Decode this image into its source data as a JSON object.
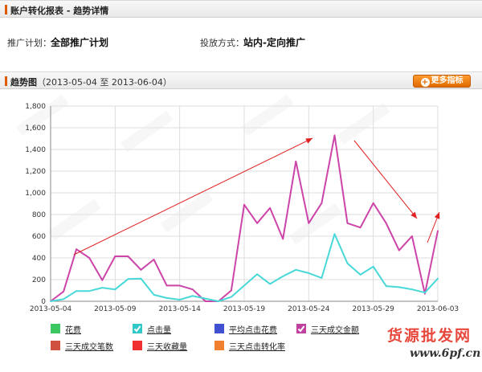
{
  "report": {
    "title": "账户转化报表",
    "separator": " - ",
    "subtitle": "趋势详情"
  },
  "filters": {
    "plan_label": "推广计划：",
    "plan_value": "全部推广计划",
    "mode_label": "投放方式：",
    "mode_value": "站内-定向推广"
  },
  "trend": {
    "title": "趋势图",
    "range": "（2013-05-04 至 2013-06-04）",
    "more_button": "更多指标",
    "more_plus": "+"
  },
  "chart_data": {
    "type": "line",
    "y_ticks": [
      "0",
      "200",
      "400",
      "600",
      "800",
      "1,000",
      "1,200",
      "1,400",
      "1,600",
      "1,800"
    ],
    "ylim": [
      0,
      1800
    ],
    "x_labels": [
      "2013-05-04",
      "2013-05-09",
      "2013-05-14",
      "2013-05-19",
      "2013-05-24",
      "2013-05-29",
      "2013-06-03"
    ],
    "x_count": 31,
    "grid": true,
    "series": [
      {
        "name": "三天成交金额",
        "color": "#cc44a8",
        "values": [
          0,
          90,
          480,
          400,
          195,
          415,
          415,
          290,
          385,
          145,
          145,
          110,
          0,
          0,
          100,
          890,
          720,
          860,
          575,
          1290,
          720,
          905,
          1530,
          720,
          680,
          905,
          720,
          470,
          600,
          70,
          650
        ]
      },
      {
        "name": "点击量",
        "color": "#48d8d8",
        "values": [
          0,
          20,
          95,
          95,
          125,
          110,
          205,
          210,
          60,
          30,
          15,
          50,
          25,
          0,
          40,
          145,
          250,
          160,
          230,
          290,
          260,
          215,
          620,
          350,
          245,
          320,
          140,
          130,
          110,
          80,
          210
        ]
      }
    ]
  },
  "legend": [
    {
      "label": "花费",
      "color": "#3cc860",
      "icon": "check-icon"
    },
    {
      "label": "点击量",
      "color": "#30c8c8",
      "icon": "check-icon",
      "checked": true
    },
    {
      "label": "平均点击花费",
      "color": "#4050d0",
      "icon": "check-icon"
    },
    {
      "label": "三天成交金额",
      "color": "#c040a0",
      "icon": "check-icon",
      "checked": true
    },
    {
      "label": "三天成交笔数",
      "color": "#d05040",
      "icon": "check-icon"
    },
    {
      "label": "三天收藏量",
      "color": "#f03030",
      "icon": "check-icon"
    },
    {
      "label": "三天点击转化率",
      "color": "#f08030",
      "icon": "check-icon"
    }
  ],
  "watermark": {
    "line1": "货源批发网",
    "line2": "www.6pf.cn"
  },
  "annotation_color": "#e02020"
}
